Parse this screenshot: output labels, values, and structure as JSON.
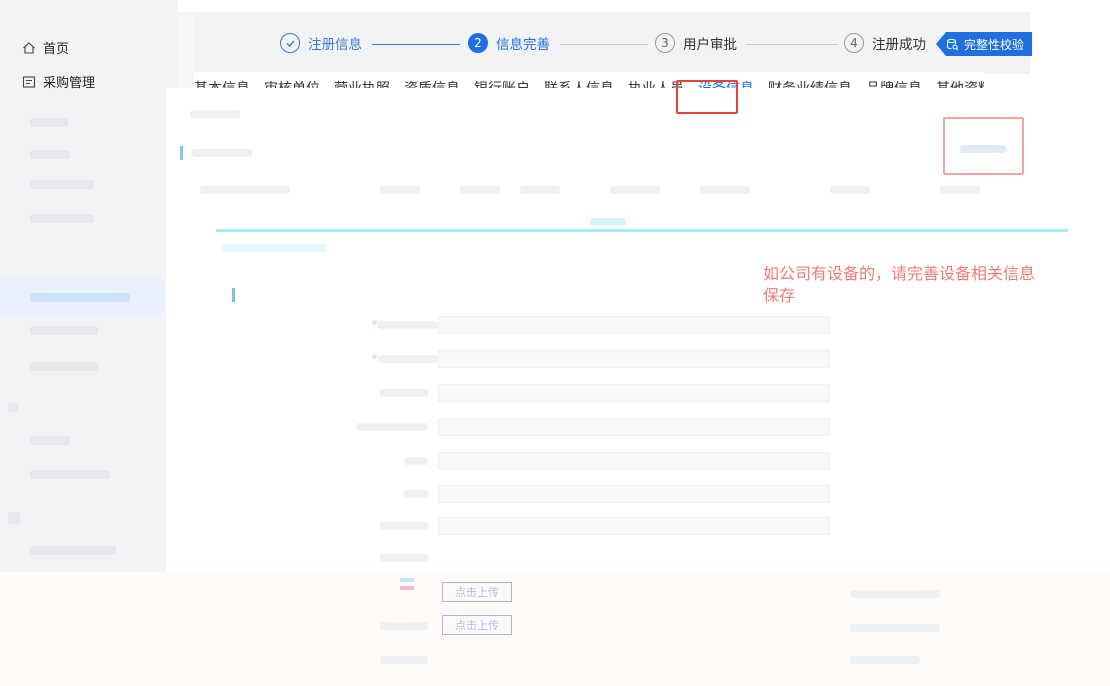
{
  "sidebar": {
    "items": [
      {
        "label": "首页",
        "icon": "home-icon"
      },
      {
        "label": "采购管理",
        "icon": "document-icon"
      }
    ]
  },
  "steps": [
    {
      "label": "注册信息",
      "num": "✓",
      "state": "done"
    },
    {
      "label": "信息完善",
      "num": "2",
      "state": "active"
    },
    {
      "label": "用户审批",
      "num": "3",
      "state": "todo"
    },
    {
      "label": "注册成功",
      "num": "4",
      "state": "todo"
    }
  ],
  "check_button": {
    "label": "完整性校验",
    "icon": "database-search-icon"
  },
  "tabs": [
    {
      "label": "基本信息"
    },
    {
      "label": "审核单位"
    },
    {
      "label": "营业执照"
    },
    {
      "label": "资质信息"
    },
    {
      "label": "银行账户"
    },
    {
      "label": "联系人信息"
    },
    {
      "label": "执业人员"
    },
    {
      "label": "设备信息",
      "active": true
    },
    {
      "label": "财务业绩信息"
    },
    {
      "label": "品牌信息"
    },
    {
      "label": "其他资料"
    }
  ],
  "annotation": {
    "text": "如公司有设备的，请完善设备相关信息保存"
  },
  "upload": {
    "label1": "点击上传",
    "label2": "点击上传"
  },
  "colors": {
    "primary": "#1f6fe0",
    "annotation": "#f07c75",
    "highlight": "#e8413a"
  }
}
